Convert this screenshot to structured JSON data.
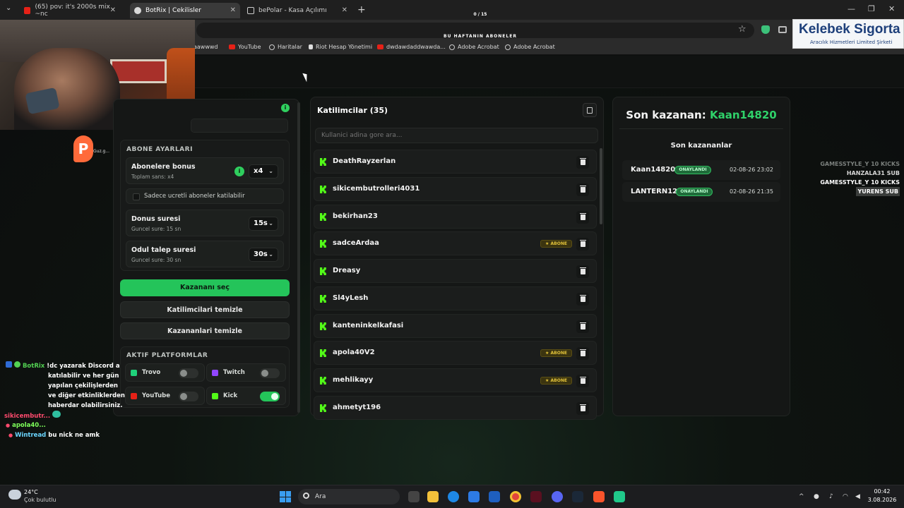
{
  "browser": {
    "tabs": [
      {
        "label": "(65) pov: it's 2000s mix ~nc",
        "favicon_color": "#e62117"
      },
      {
        "label": "BotRix | Cekilisler",
        "favicon_color": "#d9d9d9"
      },
      {
        "label": "bePolar - Kasa Açılımı",
        "favicon_color": "#9aa0a6"
      }
    ],
    "bookmarks": [
      {
        "label": "aawwwd",
        "icon": "youtube"
      },
      {
        "label": "YouTube",
        "icon": "youtube"
      },
      {
        "label": "Haritalar",
        "icon": "globe"
      },
      {
        "label": "Riot Hesap Yönetimi",
        "icon": "riot"
      },
      {
        "label": "dwdawdaddwawda...",
        "icon": "youtube"
      },
      {
        "label": "Adobe Acrobat",
        "icon": "globe"
      },
      {
        "label": "Adobe Acrobat",
        "icon": "globe"
      }
    ]
  },
  "stream_overlay": {
    "counter": "0 / 15",
    "week_title": "BU HAFTANIN ABONELER",
    "sponsor_name": "Kelebek Sigorta",
    "sponsor_sub": "Aracılık Hizmetleri Limited Şirketi",
    "logo_text": "Guz.g..."
  },
  "settings": {
    "section_title": "ABONE AYARLARI",
    "bonus": {
      "label": "Abonelere bonus",
      "sub": "Toplam sans: x4",
      "value": "x4"
    },
    "paid_only_label": "Sadece ucretli aboneler katilabilir",
    "donus": {
      "label": "Donus suresi",
      "sub": "Guncel sure: 15 sn",
      "value": "15s"
    },
    "odul": {
      "label": "Odul talep suresi",
      "sub": "Guncel sure: 30 sn",
      "value": "30s"
    },
    "pick_winner": "Kazananı seç",
    "clear_participants": "Katilimcilari temizle",
    "clear_winners": "Kazananlari temizle",
    "platforms_title": "AKTIF PLATFORMLAR",
    "platforms": [
      {
        "name": "Trovo",
        "on": false,
        "color": "#1fd17a"
      },
      {
        "name": "Twitch",
        "on": false,
        "color": "#9146ff"
      },
      {
        "name": "YouTube",
        "on": false,
        "color": "#e62117"
      },
      {
        "name": "Kick",
        "on": true,
        "color": "#53fc18"
      }
    ]
  },
  "participants": {
    "title": "Katilimcilar (35)",
    "search_placeholder": "Kullanici adina gore ara...",
    "badge_label": "ABONE",
    "items": [
      {
        "name": "DeathRayzerlan",
        "sub": false
      },
      {
        "name": "sikicembutrolleri4031",
        "sub": false
      },
      {
        "name": "bekirhan23",
        "sub": false
      },
      {
        "name": "sadceArdaa",
        "sub": true
      },
      {
        "name": "Dreasy",
        "sub": false
      },
      {
        "name": "Sl4yLesh",
        "sub": false
      },
      {
        "name": "kanteninkelkafasi",
        "sub": false
      },
      {
        "name": "apola40V2",
        "sub": true
      },
      {
        "name": "mehlikayy",
        "sub": true
      },
      {
        "name": "ahmetyt196",
        "sub": false
      }
    ]
  },
  "winners": {
    "last_label": "Son kazanan:",
    "last_name": "Kaan14820",
    "recent_title": "Son kazananlar",
    "status_label": "ONAYLANDI",
    "items": [
      {
        "name": "Kaan14820",
        "date": "02-08-26 23:02"
      },
      {
        "name": "LANTERN12",
        "date": "02-08-26 21:35"
      }
    ]
  },
  "alerts": [
    {
      "text": "GAMESSTYLE_Y 10 KICKS",
      "color": "#7a7f7c"
    },
    {
      "text": "HANZALA31 SUB",
      "color": "#d6d6d6"
    },
    {
      "text": "GAMESSTYLE_Y 10 KICKS",
      "color": "#ffffff"
    },
    {
      "text": "YURENS SUB",
      "color": "#ffffff"
    }
  ],
  "chat": [
    {
      "user": "BotRix",
      "user_color": "#52d152",
      "msg": "!dc yazarak Discord a"
    },
    {
      "user": "",
      "user_color": "",
      "msg": "katılabilir ve her gün"
    },
    {
      "user": "",
      "user_color": "",
      "msg": "yapılan çekilişlerden"
    },
    {
      "user": "",
      "user_color": "",
      "msg": "ve diğer etkinliklerden"
    },
    {
      "user": "",
      "user_color": "",
      "msg": "haberdar olabilirsiniz."
    },
    {
      "user": "sikicembutr...",
      "user_color": "#ff4b6e",
      "msg": ""
    },
    {
      "user": "apola40...",
      "user_color": "#7dff5a",
      "msg": ""
    },
    {
      "user": "Wintread",
      "user_color": "#6bd6ff",
      "msg": "bu nick ne amk"
    }
  ],
  "taskbar": {
    "temp": "24°C",
    "weather": "Çok bulutlu",
    "search": "Ara",
    "time": "00:42",
    "date": "3.08.2026"
  }
}
